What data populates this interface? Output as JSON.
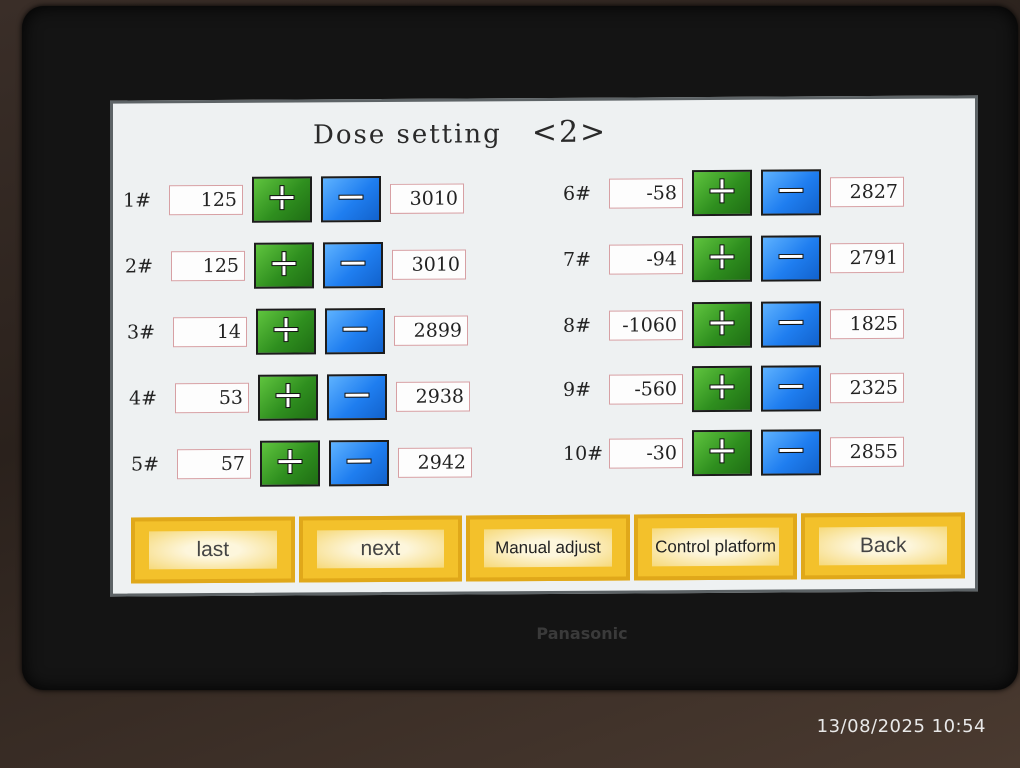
{
  "screen": {
    "title": "Dose setting",
    "page_indicator": "<2>"
  },
  "left_rows": [
    {
      "label": "1#",
      "value": "125",
      "output": "3010"
    },
    {
      "label": "2#",
      "value": "125",
      "output": "3010"
    },
    {
      "label": "3#",
      "value": "14",
      "output": "2899"
    },
    {
      "label": "4#",
      "value": "53",
      "output": "2938"
    },
    {
      "label": "5#",
      "value": "57",
      "output": "2942"
    }
  ],
  "right_rows": [
    {
      "label": "6#",
      "value": "-58",
      "output": "2827"
    },
    {
      "label": "7#",
      "value": "-94",
      "output": "2791"
    },
    {
      "label": "8#",
      "value": "-1060",
      "output": "1825"
    },
    {
      "label": "9#",
      "value": "-560",
      "output": "2325"
    },
    {
      "label": "10#",
      "value": "-30",
      "output": "2855"
    }
  ],
  "bottom_buttons": {
    "last": "last",
    "next": "next",
    "manual": "Manual adjust",
    "control": "Control platform",
    "back": "Back"
  },
  "device": {
    "brand": "Panasonic",
    "photo_timestamp": "13/08/2025 10:54"
  },
  "icons": {
    "plus": "plus-icon",
    "minus": "minus-icon"
  },
  "colors": {
    "plus_button": "#2f8f1f",
    "minus_button": "#1f7ef0",
    "nav_button": "#f3c12b"
  }
}
